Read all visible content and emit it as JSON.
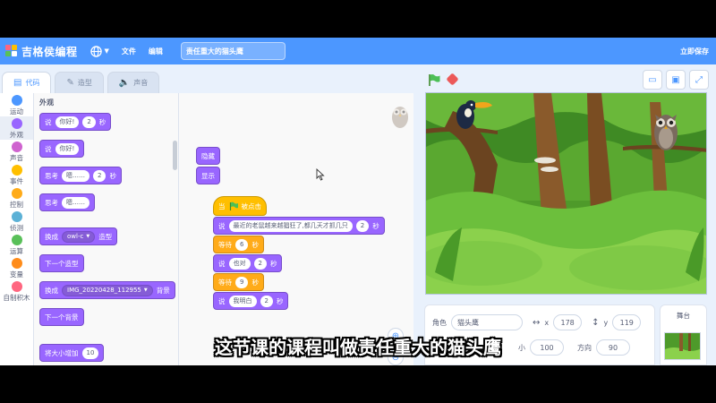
{
  "menubar": {
    "logo_text": "吉格侯编程",
    "file": "文件",
    "edit": "编辑",
    "project_title": "责任重大的猫头鹰",
    "save_now": "立即保存"
  },
  "tabs": [
    {
      "label": "代码",
      "icon": "code-icon"
    },
    {
      "label": "造型",
      "icon": "brush-icon"
    },
    {
      "label": "声音",
      "icon": "speaker-icon"
    }
  ],
  "categories": [
    {
      "label": "运动",
      "color": "#4c97ff"
    },
    {
      "label": "外观",
      "color": "#9966ff"
    },
    {
      "label": "声音",
      "color": "#cf63cf"
    },
    {
      "label": "事件",
      "color": "#ffbf00"
    },
    {
      "label": "控制",
      "color": "#ffab19"
    },
    {
      "label": "侦测",
      "color": "#5cb1d6"
    },
    {
      "label": "运算",
      "color": "#59c059"
    },
    {
      "label": "变量",
      "color": "#ff8c1a"
    },
    {
      "label": "自制积木",
      "color": "#ff6680"
    }
  ],
  "palette": {
    "title": "外观",
    "b1": {
      "label": "说",
      "text": "你好!",
      "num": "2",
      "unit": "秒"
    },
    "b2": {
      "label": "说",
      "text": "你好!"
    },
    "b3": {
      "label": "思考",
      "text": "嗯……",
      "num": "2",
      "unit": "秒"
    },
    "b4": {
      "label": "思考",
      "text": "嗯……"
    },
    "b5": {
      "label": "换成",
      "dropdown": "owl-c",
      "suffix": "造型"
    },
    "b6": {
      "label": "下一个造型"
    },
    "b7": {
      "label": "换成",
      "dropdown": "IMG_20220428_112955",
      "suffix": "背景"
    },
    "b8": {
      "label": "下一个背景"
    },
    "b9": {
      "label": "将大小增加",
      "num": "10"
    }
  },
  "scripts": {
    "hide": "隐藏",
    "show": "显示",
    "hat": {
      "when": "当",
      "clicked": "被点击"
    },
    "s1": {
      "label": "说",
      "text": "最近的老鼠越来越猖狂了,都几天才抓几只",
      "num": "2",
      "unit": "秒"
    },
    "w1": {
      "label": "等待",
      "num": "6",
      "unit": "秒"
    },
    "s2": {
      "label": "说",
      "text": "也对",
      "num": "2",
      "unit": "秒"
    },
    "w2": {
      "label": "等待",
      "num": "9",
      "unit": "秒"
    },
    "s3": {
      "label": "说",
      "text": "我明白",
      "num": "2",
      "unit": "秒"
    }
  },
  "sprite_info": {
    "sprite_label": "角色",
    "sprite_name": "猫头鹰",
    "x_label": "x",
    "x_value": "178",
    "y_label": "y",
    "y_value": "119",
    "size_label": "小",
    "size_value": "100",
    "direction_label": "方向",
    "direction_value": "90"
  },
  "stage_panel": {
    "label": "舞台"
  },
  "subtitle": "这节课的课程叫做责任重大的猫头鹰",
  "colors": {
    "accent": "#4c97ff",
    "looks": "#9966ff",
    "events": "#ffbf00",
    "control": "#ffab19"
  }
}
